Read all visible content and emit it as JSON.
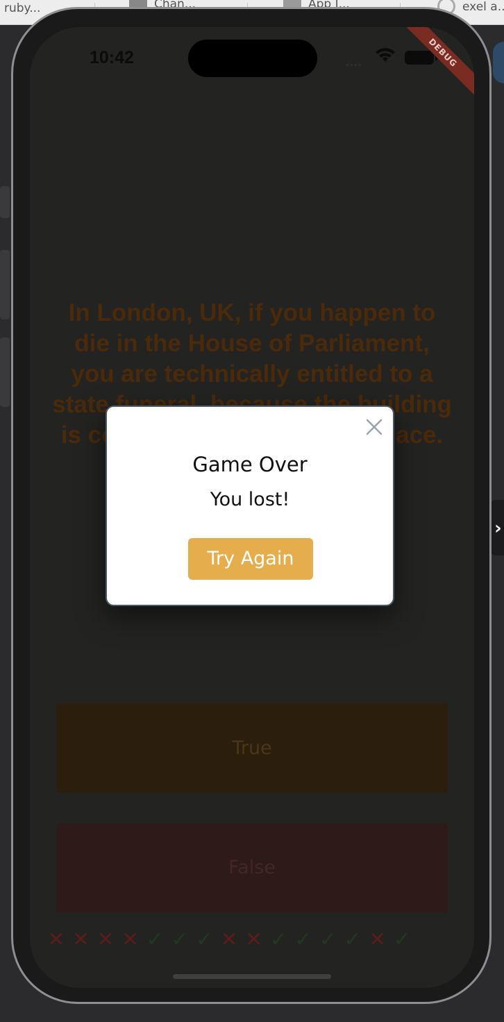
{
  "browser_tabs": [
    {
      "label": "ruby..."
    },
    {
      "label": "Chan..."
    },
    {
      "label": "App I..."
    },
    {
      "label": "exel a..."
    }
  ],
  "status_bar": {
    "time": "10:42",
    "debug_label": "DEBUG"
  },
  "question": {
    "text": "In London, UK, if you happen to die in the House of Parliament, you are technically entitled to a state funeral, because the building is considered too sacred a place."
  },
  "answers": {
    "true_label": "True",
    "false_label": "False"
  },
  "score_marks": [
    "wrong",
    "wrong",
    "wrong",
    "wrong",
    "correct",
    "correct",
    "correct",
    "wrong",
    "wrong",
    "correct",
    "correct",
    "correct",
    "correct",
    "wrong",
    "correct"
  ],
  "score_symbols": {
    "wrong": "✕",
    "correct": "✓"
  },
  "modal": {
    "title": "Game Over",
    "message": "You lost!",
    "button_label": "Try Again"
  },
  "colors": {
    "accent": "#e5ad4c",
    "wrong": "#5a1c1a",
    "correct": "#203823"
  }
}
